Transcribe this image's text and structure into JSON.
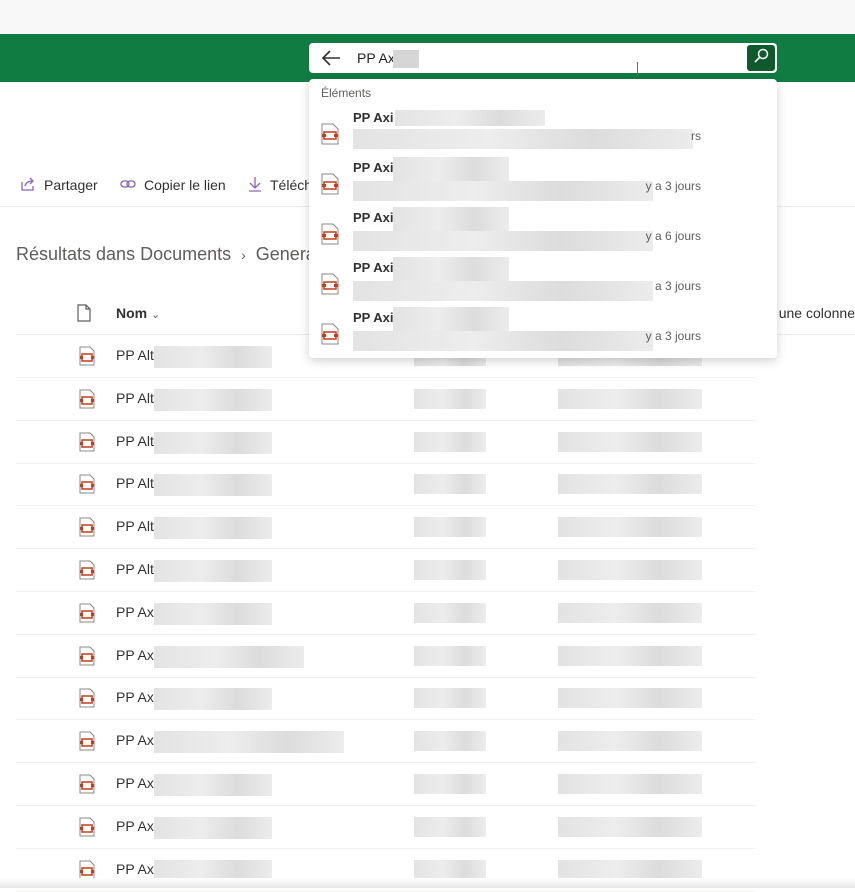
{
  "search": {
    "query": "PP Ax",
    "section_label": "Éléments",
    "suggestions": [
      {
        "name": "PP Axi",
        "meta": "rs"
      },
      {
        "name": "PP Axi",
        "meta": "y a 3 jours"
      },
      {
        "name": "PP Axi",
        "meta": "y a 6 jours"
      },
      {
        "name": "PP Axi",
        "meta": "a 3 jours"
      },
      {
        "name": "PP Axi",
        "meta": "y a 3 jours"
      }
    ]
  },
  "commands": {
    "share": "Partager",
    "copy_link": "Copier le lien",
    "download": "Téléch"
  },
  "breadcrumb": {
    "root": "Résultats dans Documents",
    "current": "Genera"
  },
  "table": {
    "col_name": "Nom",
    "col_add": "une colonne",
    "rows": [
      "PP Alt",
      "PP Alt",
      "PP Alt",
      "PP Alt",
      "PP Alt",
      "PP Alt",
      "PP Axi",
      "PP Axi",
      "PP Axi",
      "PP Axi",
      "PP Axi",
      "PP Axi",
      "PP Axi"
    ]
  },
  "colors": {
    "suite_bar": "#107c41",
    "search_button": "#0f5a2c",
    "accent": "#8764b8",
    "ppt_icon": "#c43e1c"
  },
  "icons": {
    "back": "arrow-left-icon",
    "search": "search-icon",
    "share": "share-icon",
    "link": "link-icon",
    "download": "download-icon",
    "file": "document-icon",
    "ppt": "powerpoint-file-icon"
  }
}
